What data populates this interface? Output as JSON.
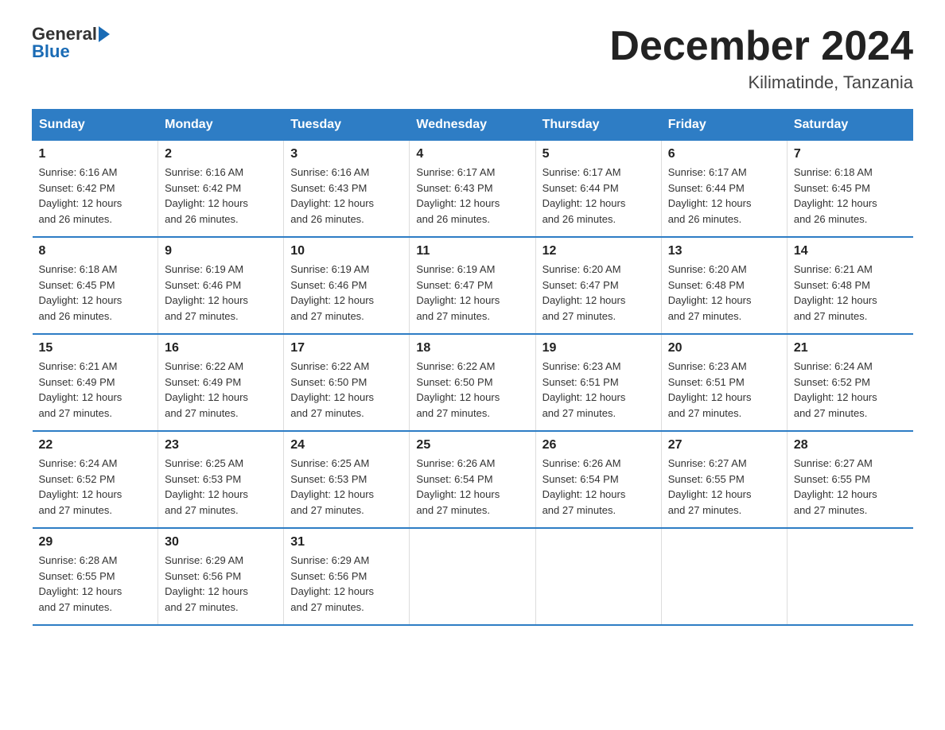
{
  "logo": {
    "text1": "General",
    "text2": "Blue"
  },
  "header": {
    "month": "December 2024",
    "location": "Kilimatinde, Tanzania"
  },
  "days_of_week": [
    "Sunday",
    "Monday",
    "Tuesday",
    "Wednesday",
    "Thursday",
    "Friday",
    "Saturday"
  ],
  "weeks": [
    [
      {
        "day": "1",
        "sunrise": "6:16 AM",
        "sunset": "6:42 PM",
        "daylight": "12 hours and 26 minutes."
      },
      {
        "day": "2",
        "sunrise": "6:16 AM",
        "sunset": "6:42 PM",
        "daylight": "12 hours and 26 minutes."
      },
      {
        "day": "3",
        "sunrise": "6:16 AM",
        "sunset": "6:43 PM",
        "daylight": "12 hours and 26 minutes."
      },
      {
        "day": "4",
        "sunrise": "6:17 AM",
        "sunset": "6:43 PM",
        "daylight": "12 hours and 26 minutes."
      },
      {
        "day": "5",
        "sunrise": "6:17 AM",
        "sunset": "6:44 PM",
        "daylight": "12 hours and 26 minutes."
      },
      {
        "day": "6",
        "sunrise": "6:17 AM",
        "sunset": "6:44 PM",
        "daylight": "12 hours and 26 minutes."
      },
      {
        "day": "7",
        "sunrise": "6:18 AM",
        "sunset": "6:45 PM",
        "daylight": "12 hours and 26 minutes."
      }
    ],
    [
      {
        "day": "8",
        "sunrise": "6:18 AM",
        "sunset": "6:45 PM",
        "daylight": "12 hours and 26 minutes."
      },
      {
        "day": "9",
        "sunrise": "6:19 AM",
        "sunset": "6:46 PM",
        "daylight": "12 hours and 27 minutes."
      },
      {
        "day": "10",
        "sunrise": "6:19 AM",
        "sunset": "6:46 PM",
        "daylight": "12 hours and 27 minutes."
      },
      {
        "day": "11",
        "sunrise": "6:19 AM",
        "sunset": "6:47 PM",
        "daylight": "12 hours and 27 minutes."
      },
      {
        "day": "12",
        "sunrise": "6:20 AM",
        "sunset": "6:47 PM",
        "daylight": "12 hours and 27 minutes."
      },
      {
        "day": "13",
        "sunrise": "6:20 AM",
        "sunset": "6:48 PM",
        "daylight": "12 hours and 27 minutes."
      },
      {
        "day": "14",
        "sunrise": "6:21 AM",
        "sunset": "6:48 PM",
        "daylight": "12 hours and 27 minutes."
      }
    ],
    [
      {
        "day": "15",
        "sunrise": "6:21 AM",
        "sunset": "6:49 PM",
        "daylight": "12 hours and 27 minutes."
      },
      {
        "day": "16",
        "sunrise": "6:22 AM",
        "sunset": "6:49 PM",
        "daylight": "12 hours and 27 minutes."
      },
      {
        "day": "17",
        "sunrise": "6:22 AM",
        "sunset": "6:50 PM",
        "daylight": "12 hours and 27 minutes."
      },
      {
        "day": "18",
        "sunrise": "6:22 AM",
        "sunset": "6:50 PM",
        "daylight": "12 hours and 27 minutes."
      },
      {
        "day": "19",
        "sunrise": "6:23 AM",
        "sunset": "6:51 PM",
        "daylight": "12 hours and 27 minutes."
      },
      {
        "day": "20",
        "sunrise": "6:23 AM",
        "sunset": "6:51 PM",
        "daylight": "12 hours and 27 minutes."
      },
      {
        "day": "21",
        "sunrise": "6:24 AM",
        "sunset": "6:52 PM",
        "daylight": "12 hours and 27 minutes."
      }
    ],
    [
      {
        "day": "22",
        "sunrise": "6:24 AM",
        "sunset": "6:52 PM",
        "daylight": "12 hours and 27 minutes."
      },
      {
        "day": "23",
        "sunrise": "6:25 AM",
        "sunset": "6:53 PM",
        "daylight": "12 hours and 27 minutes."
      },
      {
        "day": "24",
        "sunrise": "6:25 AM",
        "sunset": "6:53 PM",
        "daylight": "12 hours and 27 minutes."
      },
      {
        "day": "25",
        "sunrise": "6:26 AM",
        "sunset": "6:54 PM",
        "daylight": "12 hours and 27 minutes."
      },
      {
        "day": "26",
        "sunrise": "6:26 AM",
        "sunset": "6:54 PM",
        "daylight": "12 hours and 27 minutes."
      },
      {
        "day": "27",
        "sunrise": "6:27 AM",
        "sunset": "6:55 PM",
        "daylight": "12 hours and 27 minutes."
      },
      {
        "day": "28",
        "sunrise": "6:27 AM",
        "sunset": "6:55 PM",
        "daylight": "12 hours and 27 minutes."
      }
    ],
    [
      {
        "day": "29",
        "sunrise": "6:28 AM",
        "sunset": "6:55 PM",
        "daylight": "12 hours and 27 minutes."
      },
      {
        "day": "30",
        "sunrise": "6:29 AM",
        "sunset": "6:56 PM",
        "daylight": "12 hours and 27 minutes."
      },
      {
        "day": "31",
        "sunrise": "6:29 AM",
        "sunset": "6:56 PM",
        "daylight": "12 hours and 27 minutes."
      },
      null,
      null,
      null,
      null
    ]
  ],
  "labels": {
    "sunrise": "Sunrise:",
    "sunset": "Sunset:",
    "daylight": "Daylight:"
  }
}
